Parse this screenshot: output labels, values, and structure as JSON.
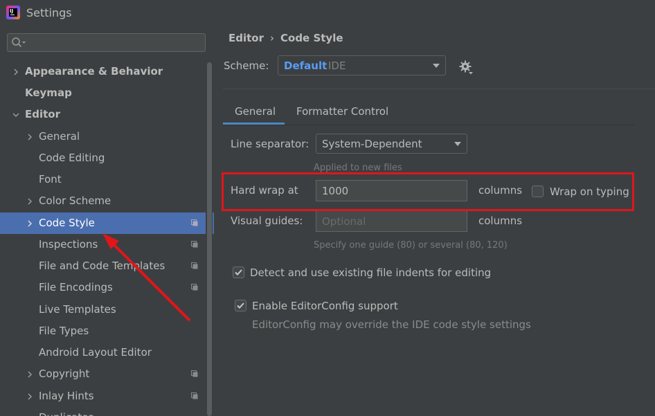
{
  "window": {
    "title": "Settings"
  },
  "search": {
    "placeholder": ""
  },
  "sidebar": {
    "items": [
      {
        "label": "Appearance & Behavior"
      },
      {
        "label": "Keymap"
      },
      {
        "label": "Editor"
      },
      {
        "label": "General"
      },
      {
        "label": "Code Editing"
      },
      {
        "label": "Font"
      },
      {
        "label": "Color Scheme"
      },
      {
        "label": "Code Style"
      },
      {
        "label": "Inspections"
      },
      {
        "label": "File and Code Templates"
      },
      {
        "label": "File Encodings"
      },
      {
        "label": "Live Templates"
      },
      {
        "label": "File Types"
      },
      {
        "label": "Android Layout Editor"
      },
      {
        "label": "Copyright"
      },
      {
        "label": "Inlay Hints"
      },
      {
        "label": "Duplicates"
      }
    ]
  },
  "breadcrumb": {
    "parent": "Editor",
    "separator": "›",
    "current": "Code Style"
  },
  "scheme": {
    "label": "Scheme:",
    "name": "Default",
    "scope": "IDE"
  },
  "tabs": {
    "general": "General",
    "formatter": "Formatter Control"
  },
  "form": {
    "line_separator_label": "Line separator:",
    "line_separator_value": "System-Dependent",
    "line_separator_hint": "Applied to new files",
    "hard_wrap_label": "Hard wrap at",
    "hard_wrap_value": "1000",
    "hard_wrap_unit": "columns",
    "wrap_on_typing_label": "Wrap on typing",
    "wrap_on_typing_checked": false,
    "visual_guides_label": "Visual guides:",
    "visual_guides_placeholder": "Optional",
    "visual_guides_unit": "columns",
    "visual_guides_hint": "Specify one guide (80) or several (80, 120)",
    "detect_indents_label": "Detect and use existing file indents for editing",
    "detect_indents_checked": true,
    "editorconfig_label": "Enable EditorConfig support",
    "editorconfig_checked": true,
    "editorconfig_hint": "EditorConfig may override the IDE code style settings"
  },
  "colors": {
    "background": "#3c3f41",
    "selection": "#4b6eaf",
    "link_blue": "#589df6",
    "annotation_red": "#e0161b"
  }
}
